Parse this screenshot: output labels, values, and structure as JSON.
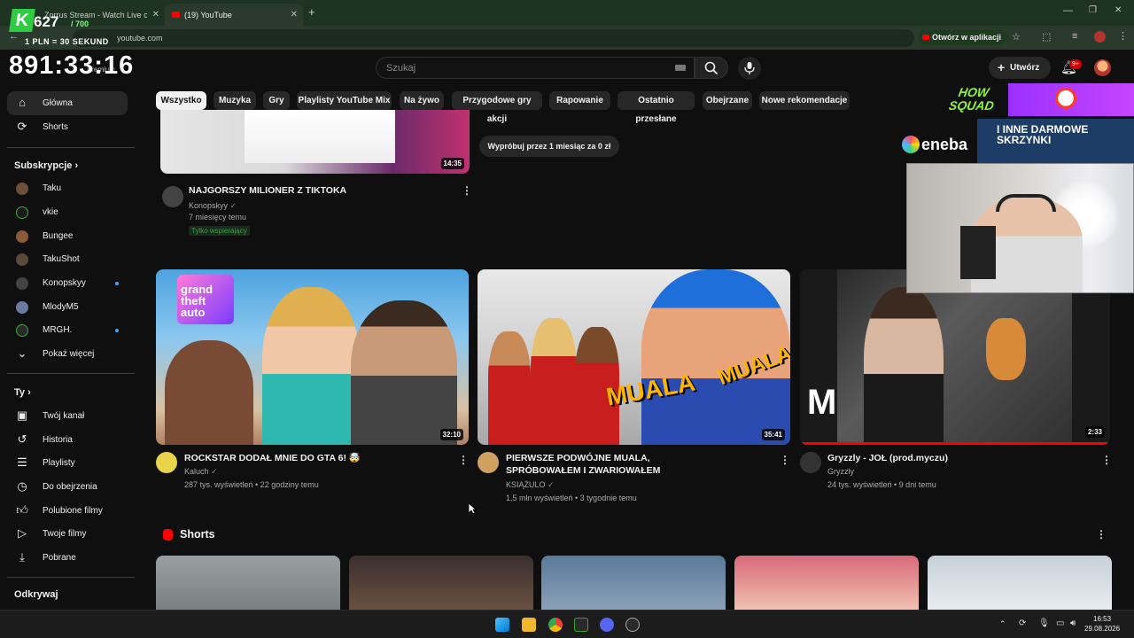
{
  "browser": {
    "tabs": [
      {
        "title": "Zorrus Stream - Watch Live on",
        "active": false
      },
      {
        "title": "(19) YouTube",
        "active": true
      }
    ],
    "url": "youtube.com",
    "open_in_app": "Otwórz w aplikacji"
  },
  "overlay": {
    "counter": "627",
    "counter_max": "/ 700",
    "rate": "1 PLN = 30 SEKUND",
    "big_number": "891:33:16",
    "howsquad": "HOW SQUAD",
    "eneba": "eneba",
    "promo": "I INNE DARMOWE SKRZYNKI"
  },
  "header": {
    "logo": "Premium",
    "search_placeholder": "Szukaj",
    "create_label": "Utwórz",
    "notif_count": "9+"
  },
  "chips": [
    "Wszystko",
    "Muzyka",
    "Gry",
    "Playlisty YouTube Mix",
    "Na żywo",
    "Przygodowe gry akcji",
    "Rapowanie",
    "Ostatnio przesłane",
    "Obejrzane",
    "Nowe rekomendacje"
  ],
  "sidebar": {
    "main": [
      {
        "label": "Główna",
        "icon": "home-icon"
      },
      {
        "label": "Shorts",
        "icon": "shorts-icon"
      }
    ],
    "subs_title": "Subskrypcje",
    "subs": [
      {
        "label": "Taku",
        "color": "#6b4f3a",
        "dot": false
      },
      {
        "label": "vkie",
        "color": "#1a1a1a",
        "dot": false
      },
      {
        "label": "Bungee",
        "color": "#8a5a3a",
        "dot": false
      },
      {
        "label": "TakuShot",
        "color": "#5a4a3a",
        "dot": false
      },
      {
        "label": "Konopskyy",
        "color": "#444444",
        "dot": true
      },
      {
        "label": "MlodyM5",
        "color": "#6a7aa0",
        "dot": false
      },
      {
        "label": "MRGH.",
        "color": "#2a2a2a",
        "dot": true
      },
      {
        "label": "Pokaż więcej",
        "color": "",
        "dot": false
      }
    ],
    "you_title": "Ty",
    "you": [
      {
        "label": "Twój kanał",
        "icon": "channel-icon"
      },
      {
        "label": "Historia",
        "icon": "history-icon"
      },
      {
        "label": "Playlisty",
        "icon": "playlist-icon"
      },
      {
        "label": "Do obejrzenia",
        "icon": "watch-later-icon"
      },
      {
        "label": "Polubione filmy",
        "icon": "like-icon"
      },
      {
        "label": "Twoje filmy",
        "icon": "video-icon"
      },
      {
        "label": "Pobrane",
        "icon": "download-icon"
      }
    ],
    "explore_title": "Odkrywaj"
  },
  "top_video": {
    "title": "NAJGORSZY MILIONER Z TIKTOKA",
    "channel": "Konopskyy",
    "meta": "7 miesięcy temu",
    "badge": "Tylko wspierający",
    "duration": "14:35"
  },
  "trial_button": "Wypróbuj przez 1 miesiąc za 0 zł",
  "videos": [
    {
      "title": "ROCKSTAR DODAŁ MNIE DO GTA 6! 🤯",
      "channel": "Kaluch",
      "meta": "287 tys. wyświetleń • 22 godziny temu",
      "duration": "32:10",
      "gta_text": "grand theft auto"
    },
    {
      "title": "PIERWSZE PODWÓJNE MUALA, SPRÓBOWAŁEM I ZWARIOWAŁEM",
      "channel": "KSIĄŻULO",
      "meta": "1,5 mln wyświetleń • 3 tygodnie temu",
      "duration": "35:41",
      "muala_text": "MUALA"
    },
    {
      "title": "Gryzzly - JOŁ (prod.myczu)",
      "channel": "Gryzzly",
      "meta": "24 tys. wyświetleń • 9 dni temu",
      "duration": "2:33",
      "progress": 1.0
    }
  ],
  "shorts_title": "Shorts",
  "taskbar": {
    "time": "16:53",
    "date": "29.08.2026"
  }
}
